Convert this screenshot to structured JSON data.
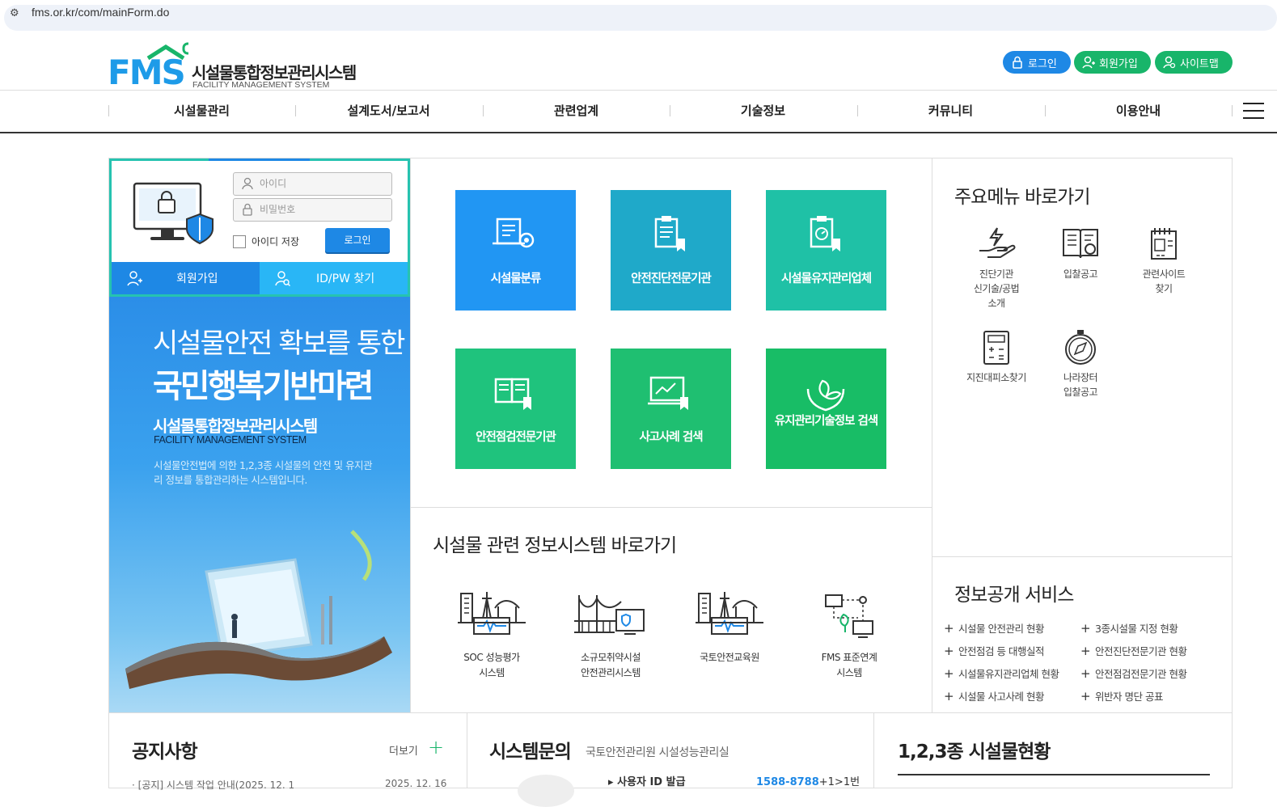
{
  "browser": {
    "url": "fms.or.kr/com/mainForm.do"
  },
  "header": {
    "logo_mark": "FMS",
    "logo_title": "시설물통합정보관리시스템",
    "logo_sub": "FACILITY MANAGEMENT SYSTEM",
    "buttons": {
      "login": "로그인",
      "join": "회원가입",
      "sitemap": "사이트맵"
    }
  },
  "gnb": [
    "시설물관리",
    "설계도서/보고서",
    "관련업계",
    "기술정보",
    "커뮤니티",
    "이용안내"
  ],
  "login_box": {
    "id_placeholder": "아이디",
    "pw_placeholder": "비밀번호",
    "save_id": "아이디 저장",
    "login_button": "로그인",
    "join_label": "회원가입",
    "find_label": "ID/PW 찾기"
  },
  "banner": {
    "line1": "시설물안전 확보를 통한",
    "line2": "국민행복기반마련",
    "line3": "시설물통합정보관리시스템",
    "line4": "FACILITY MANAGEMENT SYSTEM",
    "desc": "시설물안전법에 의한 1,2,3종 시설물의 안전 및 유지관리 정보를 통합관리하는 시스템입니다."
  },
  "tiles": [
    {
      "label": "시설물분류",
      "color": "#2196f3"
    },
    {
      "label": "안전진단전문기관",
      "color": "#1fa9c9"
    },
    {
      "label": "시설물유지관리업체",
      "color": "#1fc1a6"
    },
    {
      "label": "안전점검전문기관",
      "color": "#1fc37d"
    },
    {
      "label": "사고사례 검색",
      "color": "#1fbf71"
    },
    {
      "label": "유지관리기술정보 검색",
      "color": "#18bd66"
    }
  ],
  "systems": {
    "title": "시설물 관련 정보시스템 바로가기",
    "items": [
      {
        "line1": "SOC 성능평가",
        "line2": "시스템"
      },
      {
        "line1": "소규모취약시설",
        "line2": "안전관리시스템"
      },
      {
        "line1": "국토안전교육원",
        "line2": ""
      },
      {
        "line1": "FMS 표준연계",
        "line2": "시스템"
      }
    ]
  },
  "quick_menu": {
    "title": "주요메뉴 바로가기",
    "items": [
      {
        "line1": "진단기관",
        "line2": "신기술/공법",
        "line3": "소개"
      },
      {
        "line1": "입찰공고",
        "line2": "",
        "line3": ""
      },
      {
        "line1": "관련사이트",
        "line2": "찾기",
        "line3": ""
      },
      {
        "line1": "지진대피소찾기",
        "line2": "",
        "line3": ""
      },
      {
        "line1": "나라장터",
        "line2": "입찰공고",
        "line3": ""
      }
    ]
  },
  "info_service": {
    "title": "정보공개 서비스",
    "left": [
      "시설물 안전관리 현황",
      "안전점검 등 대행실적",
      "시설물유지관리업체 현황",
      "시설물 사고사례 현황"
    ],
    "right": [
      "3종시설물 지정 현황",
      "안전진단전문기관 현황",
      "안전점검전문기관 현황",
      "위반자 명단 공표"
    ]
  },
  "bottom": {
    "notice_title": "공지사항",
    "more": "더보기",
    "notice_first": "[공지] 시스템 작업 안내(2025. 12. 1",
    "notice_first_date": "2025. 12. 16",
    "inquiry_title": "시스템문의",
    "inquiry_sub": "국토안전관리원 시설성능관리실",
    "inquiry_item": "사용자 ID 발급",
    "inquiry_phone": "1588-8788",
    "inquiry_ext": "+1>1번",
    "facility_title": "1,2,3종 시설물현황"
  }
}
